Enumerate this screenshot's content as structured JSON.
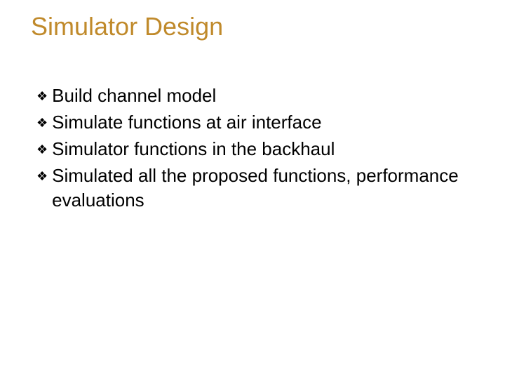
{
  "slide": {
    "title": "Simulator Design",
    "bullets": [
      "Build channel model",
      "Simulate functions at air interface",
      "Simulator functions in the backhaul",
      "Simulated all the proposed functions, performance evaluations"
    ],
    "bullet_glyph": "❖"
  }
}
